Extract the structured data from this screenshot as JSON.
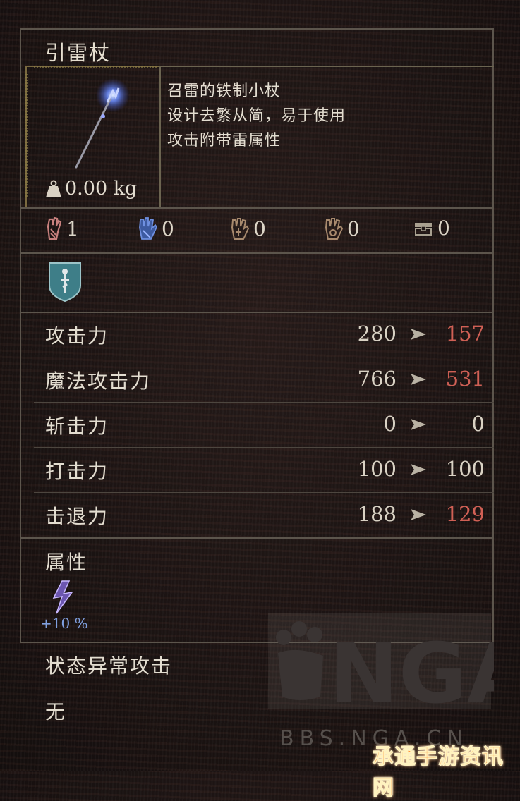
{
  "item": {
    "name": "引雷杖",
    "weight": "0.00 kg",
    "description": [
      "召雷的铁制小杖",
      "设计去繁从简，易于使用",
      "攻击附带雷属性"
    ]
  },
  "requirements": [
    {
      "icon": "strength-hand-icon",
      "value": "1",
      "color": "#c8817e"
    },
    {
      "icon": "intelligence-hand-icon",
      "value": "0",
      "color": "#5a7fc8"
    },
    {
      "icon": "faith-hand-icon",
      "value": "0",
      "color": "#a88a6e"
    },
    {
      "icon": "arcane-hand-icon",
      "value": "0",
      "color": "#a88a6e"
    },
    {
      "icon": "chest-icon",
      "value": "0",
      "color": "#a8a090"
    }
  ],
  "stats": [
    {
      "label": "攻击力",
      "base": "280",
      "new": "157",
      "changed": true
    },
    {
      "label": "魔法攻击力",
      "base": "766",
      "new": "531",
      "changed": true
    },
    {
      "label": "斩击力",
      "base": "0",
      "new": "0",
      "changed": false
    },
    {
      "label": "打击力",
      "base": "100",
      "new": "100",
      "changed": false
    },
    {
      "label": "击退力",
      "base": "188",
      "new": "129",
      "changed": true
    }
  ],
  "attribute": {
    "title": "属性",
    "lightning_bonus": "+10 %"
  },
  "status_effect": {
    "title": "状态异常攻击",
    "value": "无"
  },
  "colors": {
    "decrease": "#d06055",
    "neutral": "#d9d2c4",
    "bonus": "#7fa0e0"
  },
  "watermark": {
    "logo": "NGA",
    "url": "BBS.NGA.CN",
    "corner": "承通手游资讯网"
  }
}
